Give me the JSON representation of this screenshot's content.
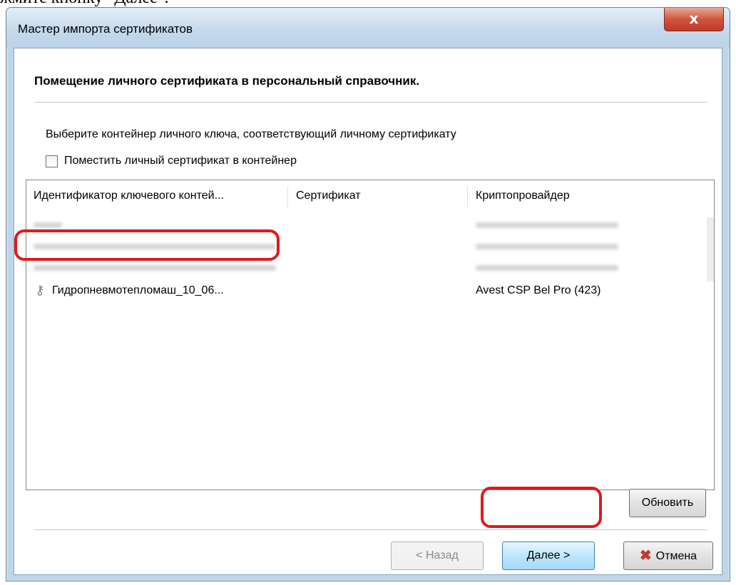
{
  "doc_fragment": "жмите кнопку \"Далее\".",
  "window": {
    "title": "Мастер импорта сертификатов",
    "close_glyph": "x"
  },
  "page": {
    "heading": "Помещение личного сертификата в персональный справочник.",
    "instruction": "Выберите контейнер личного ключа, соответствующий личному сертификату",
    "checkbox_label": "Поместить личный сертификат в контейнер",
    "checkbox_checked": false
  },
  "list": {
    "columns": [
      "Идентификатор ключевого контей...",
      "Сертификат",
      "Криптопровайдер"
    ],
    "rows": [
      {
        "id": "Гидропневмотепломаш_10_06...",
        "certificate": "",
        "provider": "Avest CSP Bel Pro (423)",
        "selected_highlight": true
      }
    ]
  },
  "buttons": {
    "refresh": "Обновить",
    "back": "< Назад",
    "next": "Далее >",
    "cancel": "Отмена"
  },
  "colors": {
    "highlight": "#e0191c",
    "title_bar": "#c6d9ec",
    "close_button": "#c0392b"
  }
}
